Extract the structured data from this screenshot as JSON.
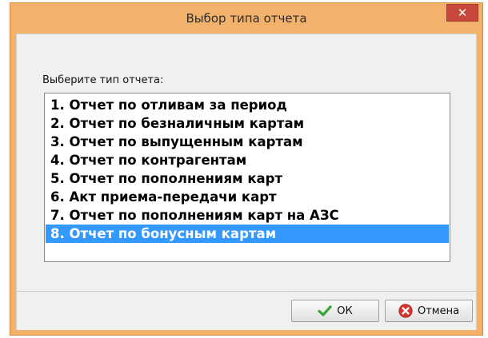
{
  "window": {
    "title": "Выбор типа отчета",
    "close_glyph": "✕"
  },
  "prompt": "Выберите тип отчета:",
  "list": {
    "items": [
      {
        "label": "1. Отчет по отливам за период",
        "selected": false
      },
      {
        "label": "2. Отчет по безналичным картам",
        "selected": false
      },
      {
        "label": "3. Отчет по выпущенным картам",
        "selected": false
      },
      {
        "label": "4. Отчет по контрагентам",
        "selected": false
      },
      {
        "label": "5. Отчет по пополнениям карт",
        "selected": false
      },
      {
        "label": "6. Акт приема-передачи карт",
        "selected": false
      },
      {
        "label": "7. Отчет по пополнениям карт на АЗС",
        "selected": false
      },
      {
        "label": "8. Отчет по бонусным картам",
        "selected": true
      }
    ]
  },
  "buttons": {
    "ok": {
      "label": "ОК",
      "icon": "checkmark-icon"
    },
    "cancel": {
      "label": "Отмена",
      "icon": "cancel-icon"
    }
  },
  "colors": {
    "titlebar": "#f3b26b",
    "selection": "#3399ff",
    "close": "#c8473b"
  }
}
